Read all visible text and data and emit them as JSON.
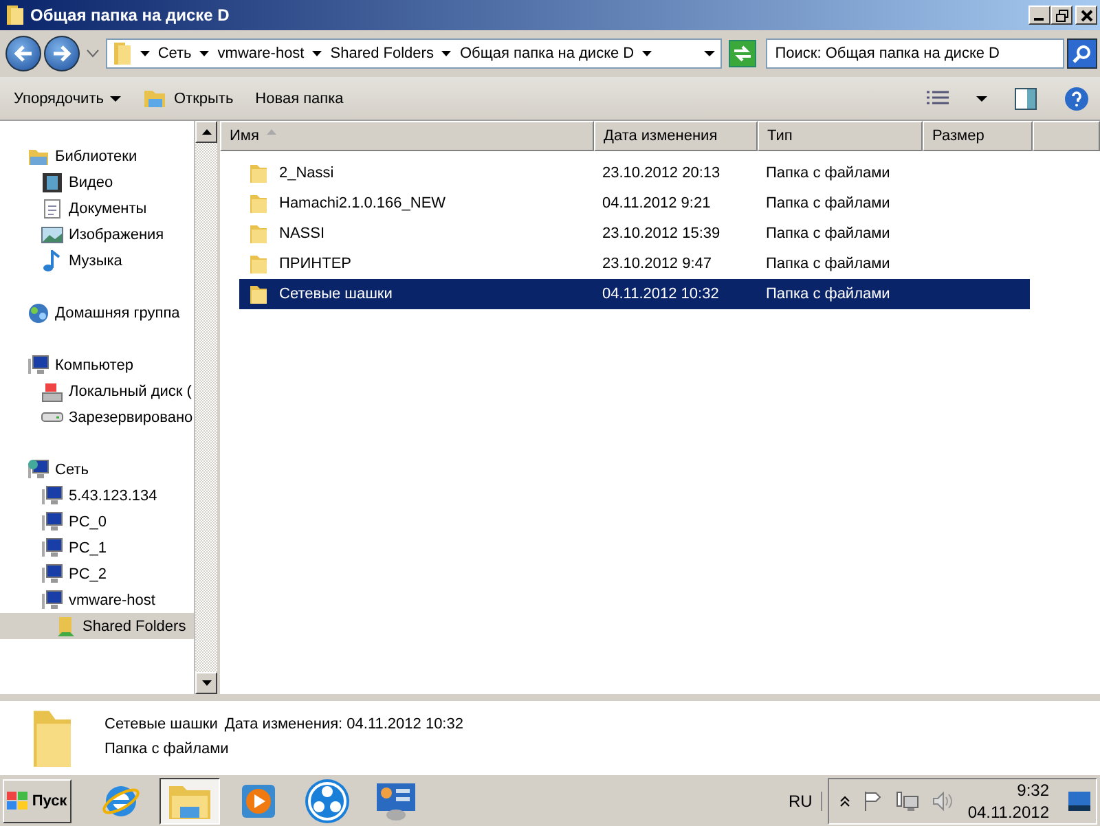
{
  "window": {
    "title": "Общая папка на диске D"
  },
  "address": {
    "segments": [
      "Сеть",
      "vmware-host",
      "Shared Folders",
      "Общая папка на диске D"
    ]
  },
  "search": {
    "placeholder": "Поиск: Общая папка на диске D"
  },
  "toolbar": {
    "items": [
      {
        "label": "Упорядочить",
        "kind": "menu"
      },
      {
        "label": "Открыть",
        "kind": "open"
      },
      {
        "label": "Новая папка",
        "kind": "plain"
      }
    ]
  },
  "navigation": {
    "items": [
      {
        "label": "Библиотеки",
        "kind": "library",
        "selected": false,
        "children": [
          {
            "label": "Видео",
            "kind": "video",
            "selected": false
          },
          {
            "label": "Документы",
            "kind": "document",
            "selected": false
          },
          {
            "label": "Изображения",
            "kind": "image",
            "selected": false
          },
          {
            "label": "Музыка",
            "kind": "music",
            "selected": false
          }
        ]
      },
      {
        "label": "Домашняя группа",
        "kind": "homegroup",
        "selected": false
      },
      {
        "label": "Компьютер",
        "kind": "computer",
        "selected": false,
        "children": [
          {
            "label": "Локальный диск (",
            "kind": "disk",
            "selected": false
          },
          {
            "label": "Зарезервировано",
            "kind": "drive",
            "selected": false
          }
        ]
      },
      {
        "label": "Сеть",
        "kind": "network",
        "selected": false,
        "children": [
          {
            "label": "5.43.123.134",
            "kind": "pc",
            "selected": false
          },
          {
            "label": "PC_0",
            "kind": "pc",
            "selected": false
          },
          {
            "label": "PC_1",
            "kind": "pc",
            "selected": false
          },
          {
            "label": "PC_2",
            "kind": "pc",
            "selected": false
          },
          {
            "label": "vmware-host",
            "kind": "pc",
            "selected": false,
            "children": [
              {
                "label": "Shared Folders",
                "kind": "share",
                "selected": true
              }
            ]
          }
        ]
      }
    ]
  },
  "table": {
    "columns": [
      {
        "label": "Имя",
        "sorted": true
      },
      {
        "label": "Дата изменения",
        "sorted": false
      },
      {
        "label": "Тип",
        "sorted": false
      },
      {
        "label": "Размер",
        "sorted": false
      }
    ],
    "rows": [
      {
        "name": "2_Nassi",
        "date": "23.10.2012 20:13",
        "type": "Папка с файлами",
        "selected": false
      },
      {
        "name": "Hamachi2.1.0.166_NEW",
        "date": "04.11.2012 9:21",
        "type": "Папка с файлами",
        "selected": false
      },
      {
        "name": "NASSI",
        "date": "23.10.2012 15:39",
        "type": "Папка с файлами",
        "selected": false
      },
      {
        "name": "ПРИНТЕР",
        "date": "23.10.2012 9:47",
        "type": "Папка с файлами",
        "selected": false
      },
      {
        "name": "Сетевые шашки",
        "date": "04.11.2012 10:32",
        "type": "Папка с файлами",
        "selected": true
      }
    ]
  },
  "details": {
    "name": "Сетевые шашки",
    "modified": "Дата изменения: 04.11.2012 10:32",
    "type": "Папка с файлами"
  },
  "taskbar": {
    "start": "Пуск",
    "apps": [
      {
        "kind": "browser",
        "selected": false
      },
      {
        "kind": "explorer",
        "selected": true
      },
      {
        "kind": "media",
        "selected": false
      },
      {
        "kind": "network",
        "selected": false
      },
      {
        "kind": "panel",
        "selected": false
      }
    ],
    "language": "RU",
    "time": "9:32",
    "date": "04.11.2012"
  }
}
